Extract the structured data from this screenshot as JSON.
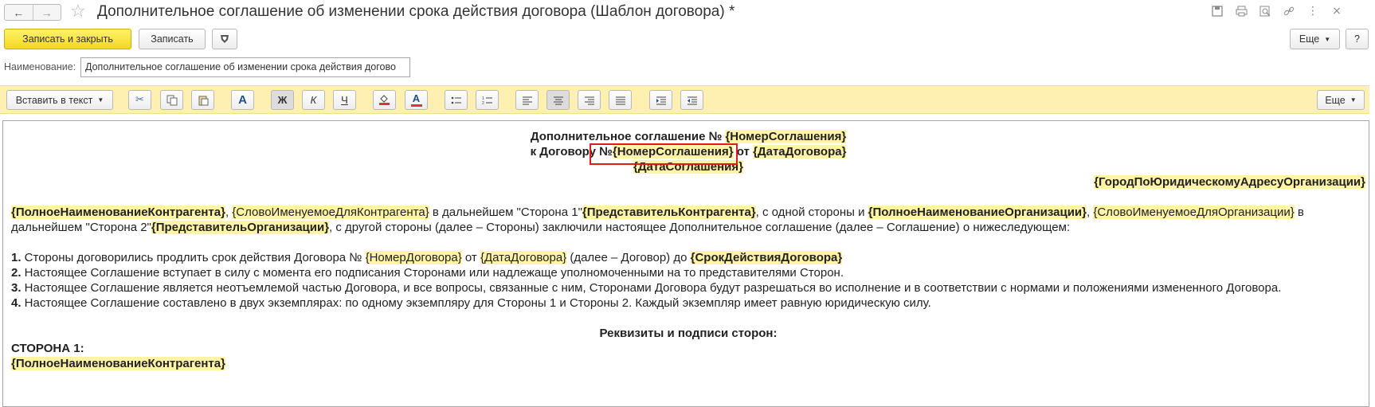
{
  "window": {
    "back_icon": "arrow-left-icon",
    "forward_icon": "arrow-right-icon",
    "favorite_icon": "star-icon",
    "title": "Дополнительное соглашение об изменении срока действия договора (Шаблон договора) *",
    "icons": [
      "save-icon",
      "print-icon",
      "preview-icon",
      "link-icon",
      "more-icon",
      "close-icon"
    ]
  },
  "toolbar": {
    "save_close_label": "Записать и закрыть",
    "save_label": "Записать",
    "more_label": "Еще",
    "help_label": "?"
  },
  "name_field": {
    "label": "Наименование:",
    "value": "Дополнительное соглашение об изменении срока действия догово"
  },
  "format_toolbar": {
    "insert_label": "Вставить в текст",
    "more_label": "Еще",
    "bold_glyph": "Ж",
    "italic_glyph": "К",
    "underline_glyph": "Ч",
    "font_glyph": "A",
    "color_glyph": "A"
  },
  "document": {
    "header1_prefix": "Дополнительное соглашение № ",
    "header1_field": "{НомерСоглашения}",
    "header2_prefix": "к Договору №",
    "header2_field": "{НомерСоглашения}",
    "header2_mid": " от ",
    "header2_field2": "{ДатаДоговора}",
    "header3_field": "{ДатаСоглашения}",
    "city_field": "{ГородПоЮридическомуАдресуОрганизации}",
    "p1_f1": "{ПолноеНаименованиеКонтрагента}",
    "p1_t1": ", ",
    "p1_f2": "{СловоИменуемоеДляКонтрагента}",
    "p1_t2": " в дальнейшем \"Сторона 1\"",
    "p1_f3": "{ПредставительКонтрагента}",
    "p1_t3": ", с одной стороны и ",
    "p1_f4": "{ПолноеНаименованиеОрганизации}",
    "p1_t4": ",",
    "p1_f5": "{СловоИменуемоеДляОрганизации}",
    "p1_t5": " в дальнейшем \"Сторона 2\"",
    "p1_f6": "{ПредставительОрганизации}",
    "p1_t6": ", с другой стороны (далее – Стороны) заключили настоящее Дополнительное соглашение (далее – Соглашение) о нижеследующем:",
    "item1_num": "1.",
    "item1_t1": " Стороны договорились продлить срок действия Договора № ",
    "item1_f1": "{НомерДоговора}",
    "item1_t2": " от ",
    "item1_f2": "{ДатаДоговора}",
    "item1_t3": " (далее – Договор) до ",
    "item1_f3": "{СрокДействияДоговора}",
    "item2_num": "2.",
    "item2_t": " Настоящее Соглашение вступает в силу с момента его подписания Сторонами или надлежаще уполномоченными на то представителями Сторон.",
    "item3_num": "3.",
    "item3_t": " Настоящее Соглашение является неотъемлемой частью Договора, и все вопросы, связанные с ним, Сторонами Договора будут разрешаться во исполнение и в соответствии с нормами и положениями измененного Договора.",
    "item4_num": "4.",
    "item4_t": " Настоящее Соглашение составлено в двух экземплярах: по одному экземпляру для Стороны 1 и Стороны 2. Каждый экземпляр имеет равную юридическую силу.",
    "requisites": "Реквизиты и подписи сторон:",
    "side1": "СТОРОНА 1:",
    "side1_field": "{ПолноеНаименованиеКонтрагента}"
  },
  "colors": {
    "primary_button": "#f4d71f",
    "field_highlight": "#fff3a6",
    "toolbar_background": "#fdf0b0",
    "annotation_box": "#e01b1b"
  }
}
